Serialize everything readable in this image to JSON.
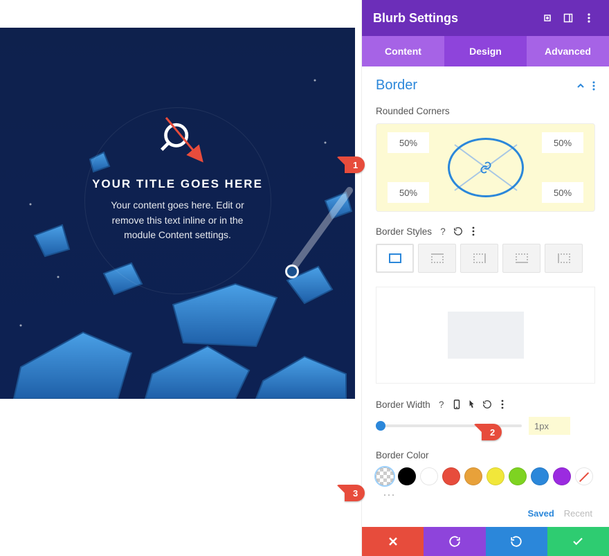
{
  "panel": {
    "title": "Blurb Settings",
    "tabs": {
      "content": "Content",
      "design": "Design",
      "advanced": "Advanced"
    },
    "section": "Border",
    "rounded_label": "Rounded Corners",
    "corner": {
      "tl": "50%",
      "tr": "50%",
      "bl": "50%",
      "br": "50%"
    },
    "styles_label": "Border Styles",
    "width_label": "Border Width",
    "width_value": "1px",
    "color_label": "Border Color",
    "swatches": [
      {
        "name": "transparent",
        "css": "checker",
        "selected": true
      },
      {
        "name": "black",
        "hex": "#000000"
      },
      {
        "name": "white",
        "hex": "#ffffff"
      },
      {
        "name": "red",
        "hex": "#e74c3c"
      },
      {
        "name": "orange",
        "hex": "#e8a13a"
      },
      {
        "name": "yellow",
        "hex": "#f1e73a"
      },
      {
        "name": "green",
        "hex": "#7ed321"
      },
      {
        "name": "blue",
        "hex": "#2b87da"
      },
      {
        "name": "purple",
        "hex": "#9b2be0"
      },
      {
        "name": "none",
        "css": "none"
      }
    ],
    "saved": "Saved",
    "recent": "Recent"
  },
  "blurb": {
    "title": "YOUR TITLE GOES HERE",
    "body": "Your content goes here. Edit or remove this text inline or in the module Content settings."
  },
  "pins": {
    "p1": "1",
    "p2": "2",
    "p3": "3"
  }
}
